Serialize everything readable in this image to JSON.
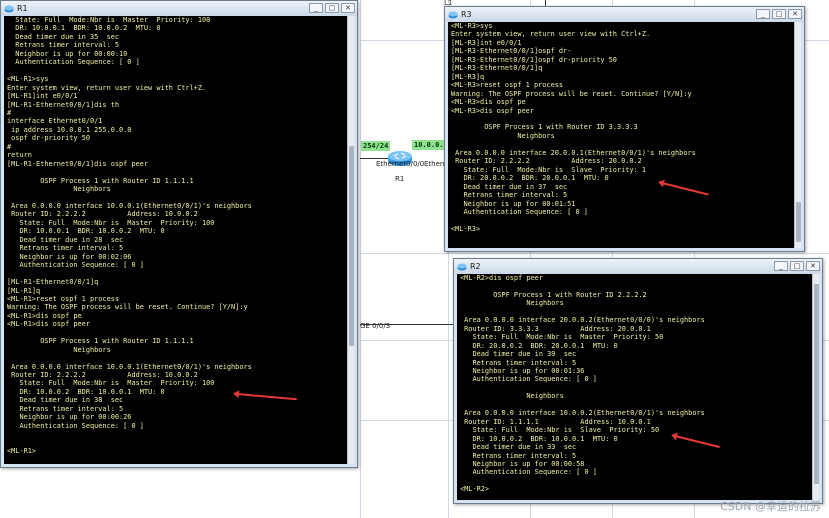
{
  "windows": {
    "r1": {
      "title": "R1"
    },
    "r3": {
      "title": "R3"
    },
    "r2": {
      "title": "R2"
    },
    "buttons": {
      "minimize": "_",
      "maximize": "□",
      "close": "✕"
    }
  },
  "topology": {
    "iface_tag_left": "254/24",
    "iface_tag_right": "10.0.0.",
    "router_label": "Ethernet0/0/0",
    "router_label_right": "Ethern",
    "router_name": "R1",
    "ge_label": "GE 0/0/3",
    "corner_label": "L1"
  },
  "r1_lines": [
    "  State: Full  Mode:Nbr is  Master  Priority: 100",
    "  DR: 10.0.0.1  BDR: 10.0.0.2  MTU: 0",
    "  Dead timer due in 35  sec",
    "  Retrans timer interval: 5",
    "  Neighbor is up for 00:00:10",
    "  Authentication Sequence: [ 0 ]",
    "",
    "<ML-R1>sys",
    "Enter system view, return user view with Ctrl+Z.",
    "[ML-R1]int e0/0/1",
    "[ML-R1-Ethernet0/0/1]dis th",
    "#",
    "interface Ethernet0/0/1",
    " ip address 10.0.0.1 255.0.0.0",
    " ospf dr-priority 50",
    "#",
    "return",
    "[ML-R1-Ethernet0/0/1]dis ospf peer",
    "",
    "        OSPF Process 1 with Router ID 1.1.1.1",
    "                Neighbors",
    "",
    " Area 0.0.0.0 interface 10.0.0.1(Ethernet0/0/1)'s neighbors",
    " Router ID: 2.2.2.2          Address: 10.0.0.2",
    "   State: Full  Mode:Nbr is  Master  Priority: 100",
    "   DR: 10.0.0.1  BDR: 10.0.0.2  MTU: 0",
    "   Dead timer due in 28  sec",
    "   Retrans timer interval: 5",
    "   Neighbor is up for 00:02:06",
    "   Authentication Sequence: [ 0 ]",
    "",
    "[ML-R1-Ethernet0/0/1]q",
    "[ML-R1]q",
    "<ML-R1>reset ospf 1 process",
    "Warning: The OSPF process will be reset. Continue? [Y/N]:y",
    "<ML-R1>dis ospf pe",
    "<ML-R1>dis ospf peer",
    "",
    "        OSPF Process 1 with Router ID 1.1.1.1",
    "                Neighbors",
    "",
    " Area 0.0.0.0 interface 10.0.0.1(Ethernet0/0/1)'s neighbors",
    " Router ID: 2.2.2.2          Address: 10.0.0.2",
    "   State: Full  Mode:Nbr is  Master  Priority: 100",
    "   DR: 10.0.0.2  BDR: 10.0.0.1  MTU: 0",
    "   Dead timer due in 38  sec",
    "   Retrans timer interval: 5",
    "   Neighbor is up for 00:00:26",
    "   Authentication Sequence: [ 0 ]",
    "",
    "",
    "<ML-R1>"
  ],
  "r3_lines": [
    "<ML-R3>sys",
    "Enter system view, return user view with Ctrl+Z.",
    "[ML-R3]int e0/0/1",
    "[ML-R3-Ethernet0/0/1]ospf dr-",
    "[ML-R3-Ethernet0/0/1]ospf dr-priority 50",
    "[ML-R3-Ethernet0/0/1]q",
    "[ML-R3]q",
    "<ML-R3>reset ospf 1 process",
    "Warning: The OSPF process will be reset. Continue? [Y/N]:y",
    "<ML-R3>dis ospf pe",
    "<ML-R3>dis ospf peer",
    "",
    "        OSPF Process 1 with Router ID 3.3.3.3",
    "                Neighbors",
    "",
    " Area 0.0.0.0 interface 20.0.0.1(Ethernet0/0/1)'s neighbors",
    " Router ID: 2.2.2.2          Address: 20.0.0.2",
    "   State: Full  Mode:Nbr is  Slave  Priority: 1",
    "   DR: 20.0.0.2  BDR: 20.0.0.1  MTU: 0",
    "   Dead timer due in 37  sec",
    "   Retrans timer interval: 5",
    "   Neighbor is up for 00:01:51",
    "   Authentication Sequence: [ 0 ]",
    "",
    "<ML-R3>"
  ],
  "r2_lines": [
    "<ML-R2>dis ospf peer",
    "",
    "        OSPF Process 1 with Router ID 2.2.2.2",
    "                Neighbors",
    "",
    " Area 0.0.0.0 interface 20.0.0.2(Ethernet0/0/0)'s neighbors",
    " Router ID: 3.3.3.3          Address: 20.0.0.1",
    "   State: Full  Mode:Nbr is  Master  Priority: 50",
    "   DR: 20.0.0.2  BDR: 20.0.0.1  MTU: 0",
    "   Dead timer due in 39  sec",
    "   Retrans timer interval: 5",
    "   Neighbor is up for 00:01:36",
    "   Authentication Sequence: [ 0 ]",
    "",
    "                Neighbors",
    "",
    " Area 0.0.0.0 interface 10.0.0.2(Ethernet0/0/1)'s neighbors",
    " Router ID: 1.1.1.1          Address: 10.0.0.1",
    "   State: Full  Mode:Nbr is  Slave  Priority: 50",
    "   DR: 10.0.0.2  BDR: 10.0.0.1  MTU: 0",
    "   Dead timer due in 33  sec",
    "   Retrans timer interval: 5",
    "   Neighbor is up for 00:00:58",
    "   Authentication Sequence: [ 0 ]",
    "",
    "<ML-R2>"
  ],
  "watermark": "CSDN @幸运的拉苏",
  "colors": {
    "terminal_bg": "#000000",
    "terminal_text": "#f0f0a0",
    "arrow": "#e53935",
    "iface_tag": "#8fe28f"
  }
}
